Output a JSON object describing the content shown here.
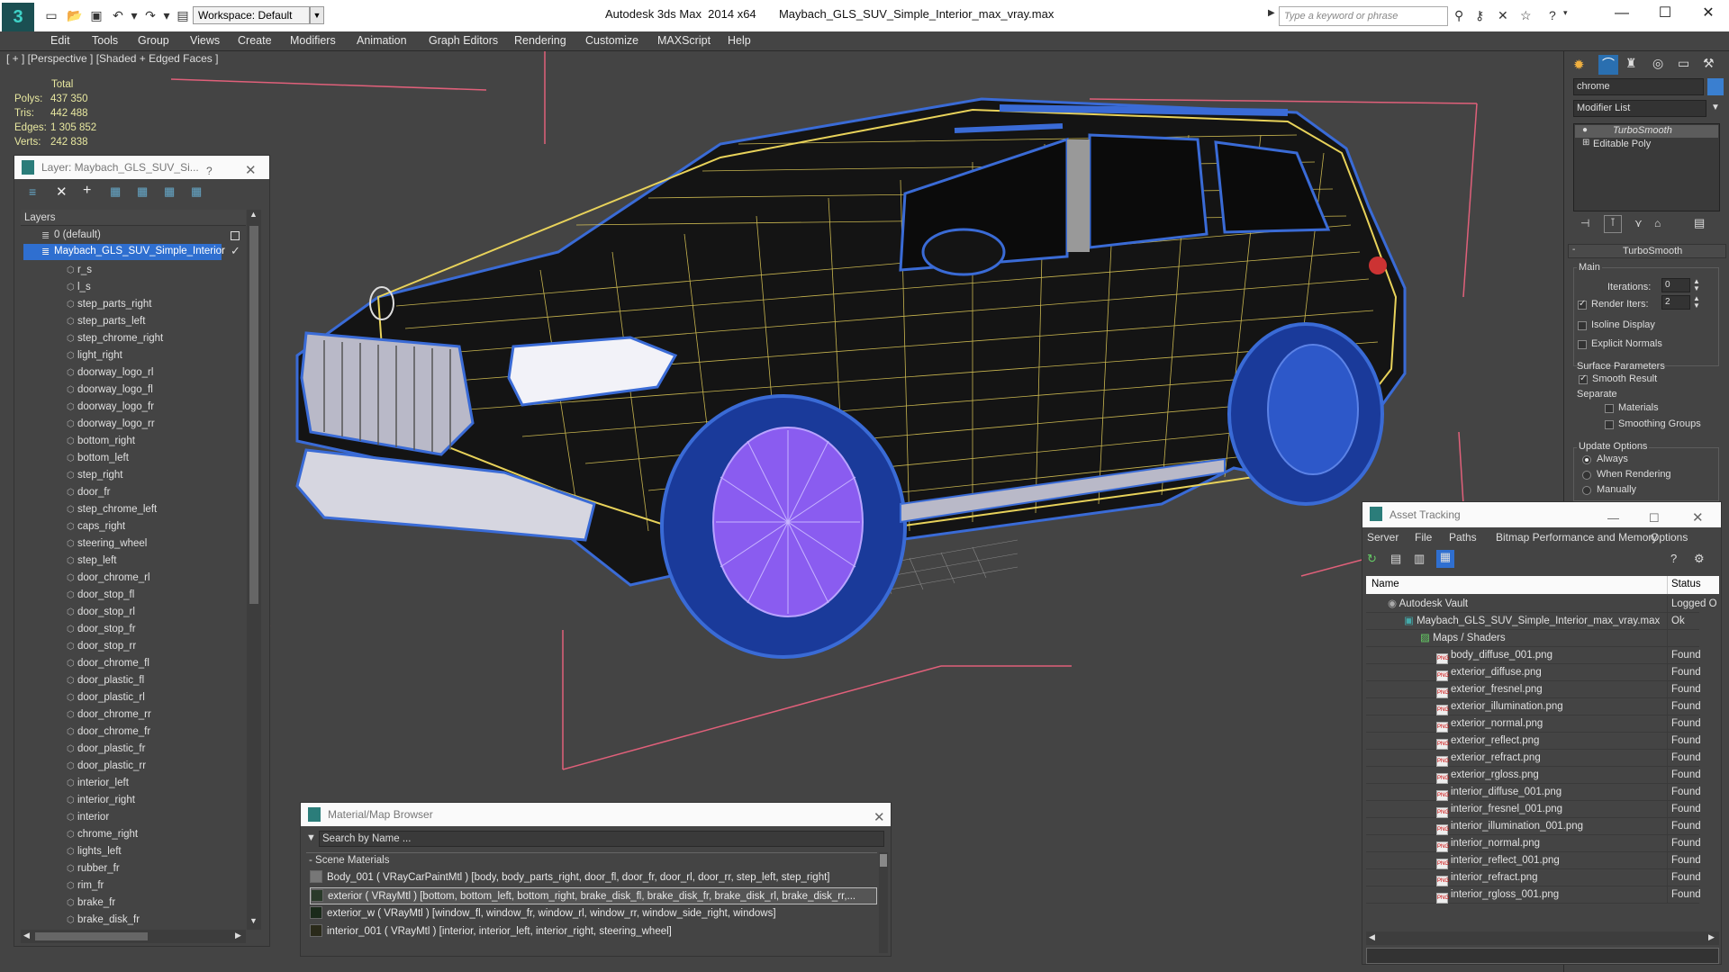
{
  "app": {
    "title": "Autodesk 3ds Max  2014 x64       Maybach_GLS_SUV_Simple_Interior_max_vray.max",
    "workspace": "Workspace: Default",
    "search_placeholder": "Type a keyword or phrase"
  },
  "menu": [
    "Edit",
    "Tools",
    "Group",
    "Views",
    "Create",
    "Modifiers",
    "Animation",
    "Graph Editors",
    "Rendering",
    "Customize",
    "MAXScript",
    "Help"
  ],
  "viewport": {
    "label": "[ + ] [Perspective ] [Shaded + Edged Faces ]",
    "stats": {
      "header": "Total",
      "rows": [
        [
          "Polys:",
          "437 350"
        ],
        [
          "Tris:",
          "442 488"
        ],
        [
          "Edges:",
          "1 305 852"
        ],
        [
          "Verts:",
          "242 838"
        ]
      ]
    }
  },
  "layer_panel": {
    "title": "Layer: Maybach_GLS_SUV_Si...",
    "help": "?",
    "column_header": "Layers",
    "default_layer": "0 (default)",
    "active_layer": "Maybach_GLS_SUV_Simple_Interior",
    "items": [
      "r_s",
      "l_s",
      "step_parts_right",
      "step_parts_left",
      "step_chrome_right",
      "light_right",
      "doorway_logo_rl",
      "doorway_logo_fl",
      "doorway_logo_fr",
      "doorway_logo_rr",
      "bottom_right",
      "bottom_left",
      "step_right",
      "door_fr",
      "step_chrome_left",
      "caps_right",
      "steering_wheel",
      "step_left",
      "door_chrome_rl",
      "door_stop_fl",
      "door_stop_rl",
      "door_stop_fr",
      "door_stop_rr",
      "door_chrome_fl",
      "door_plastic_fl",
      "door_plastic_rl",
      "door_chrome_rr",
      "door_chrome_fr",
      "door_plastic_fr",
      "door_plastic_rr",
      "interior_left",
      "interior_right",
      "interior",
      "chrome_right",
      "lights_left",
      "rubber_fr",
      "rim_fr",
      "brake_fr",
      "brake_disk_fr"
    ]
  },
  "command_panel": {
    "object_name": "chrome",
    "modifier_list": "Modifier List",
    "stack": [
      "TurboSmooth",
      "Editable Poly"
    ],
    "rollout_title": "TurboSmooth",
    "main_label": "Main",
    "iterations_label": "Iterations:",
    "iterations_value": "0",
    "render_iters_label": "Render Iters:",
    "render_iters_value": "2",
    "isoline": "Isoline Display",
    "explicit": "Explicit Normals",
    "surface_params": "Surface Parameters",
    "smooth_result": "Smooth Result",
    "separate": "Separate",
    "materials": "Materials",
    "smoothing_groups": "Smoothing Groups",
    "update_options": "Update Options",
    "always": "Always",
    "when_rendering": "When Rendering",
    "manually": "Manually"
  },
  "asset_tracking": {
    "title": "Asset Tracking",
    "menu": [
      "Server",
      "File",
      "Paths",
      "Bitmap Performance and Memory",
      "Options"
    ],
    "col_name": "Name",
    "col_status": "Status",
    "rows": [
      {
        "name": "Autodesk Vault",
        "status": "Logged O",
        "indent": 0,
        "type": "vault"
      },
      {
        "name": "Maybach_GLS_SUV_Simple_Interior_max_vray.max",
        "status": "Ok",
        "indent": 1,
        "type": "max"
      },
      {
        "name": "Maps / Shaders",
        "status": "",
        "indent": 2,
        "type": "folder"
      },
      {
        "name": "body_diffuse_001.png",
        "status": "Found",
        "indent": 3,
        "type": "png"
      },
      {
        "name": "exterior_diffuse.png",
        "status": "Found",
        "indent": 3,
        "type": "png"
      },
      {
        "name": "exterior_fresnel.png",
        "status": "Found",
        "indent": 3,
        "type": "png"
      },
      {
        "name": "exterior_illumination.png",
        "status": "Found",
        "indent": 3,
        "type": "png"
      },
      {
        "name": "exterior_normal.png",
        "status": "Found",
        "indent": 3,
        "type": "png"
      },
      {
        "name": "exterior_reflect.png",
        "status": "Found",
        "indent": 3,
        "type": "png"
      },
      {
        "name": "exterior_refract.png",
        "status": "Found",
        "indent": 3,
        "type": "png"
      },
      {
        "name": "exterior_rgloss.png",
        "status": "Found",
        "indent": 3,
        "type": "png"
      },
      {
        "name": "interior_diffuse_001.png",
        "status": "Found",
        "indent": 3,
        "type": "png"
      },
      {
        "name": "interior_fresnel_001.png",
        "status": "Found",
        "indent": 3,
        "type": "png"
      },
      {
        "name": "interior_illumination_001.png",
        "status": "Found",
        "indent": 3,
        "type": "png"
      },
      {
        "name": "interior_normal.png",
        "status": "Found",
        "indent": 3,
        "type": "png"
      },
      {
        "name": "interior_reflect_001.png",
        "status": "Found",
        "indent": 3,
        "type": "png"
      },
      {
        "name": "interior_refract.png",
        "status": "Found",
        "indent": 3,
        "type": "png"
      },
      {
        "name": "interior_rgloss_001.png",
        "status": "Found",
        "indent": 3,
        "type": "png"
      }
    ]
  },
  "material_browser": {
    "title": "Material/Map Browser",
    "search_placeholder": "Search by Name ...",
    "group": "- Scene Materials",
    "rows": [
      "Body_001  ( VRayCarPaintMtl ) [body, body_parts_right, door_fl, door_fr, door_rl, door_rr, step_left, step_right]",
      "exterior  ( VRayMtl ) [bottom, bottom_left, bottom_right, brake_disk_fl, brake_disk_fr, brake_disk_rl, brake_disk_rr,...",
      "exterior_w  ( VRayMtl ) [window_fl, window_fr, window_rl, window_rr, window_side_right, windows]",
      "interior_001  ( VRayMtl ) [interior, interior_left, interior_right, steering_wheel]"
    ]
  },
  "colors": {
    "wire_yellow": "#e8d25a",
    "wire_blue": "#3a6bd6",
    "rim_purple": "#8a5cf0",
    "selection": "#2f6fd0",
    "grid_pink": "#e0607a"
  }
}
